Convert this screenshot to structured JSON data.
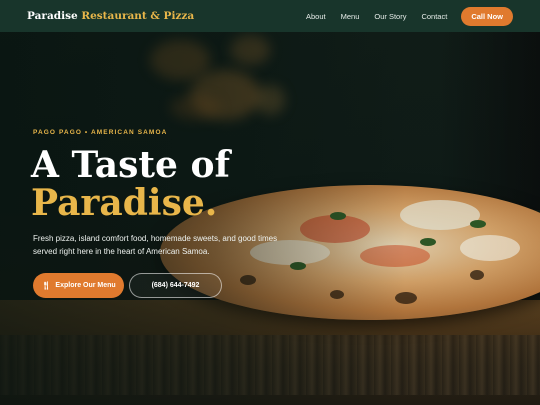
{
  "header": {
    "brand_name": "Paradise",
    "brand_accent": "Restaurant & Pizza",
    "nav": [
      "About",
      "Menu",
      "Our Story",
      "Contact"
    ],
    "cta_label": "Call Now"
  },
  "hero": {
    "eyebrow": "PAGO PAGO • AMERICAN SAMOA",
    "headline_line1": "A Taste of",
    "headline_line2": "Paradise.",
    "subtext": "Fresh pizza, island comfort food, homemade sweets, and good times served right here in the heart of American Samoa.",
    "primary_button": "Explore Our Menu",
    "primary_button_icon": "utensils-icon",
    "secondary_button": "(684) 644-7492"
  },
  "colors": {
    "header_bg": "#18352b",
    "accent_gold": "#e8b64a",
    "accent_orange": "#e07a2e"
  }
}
